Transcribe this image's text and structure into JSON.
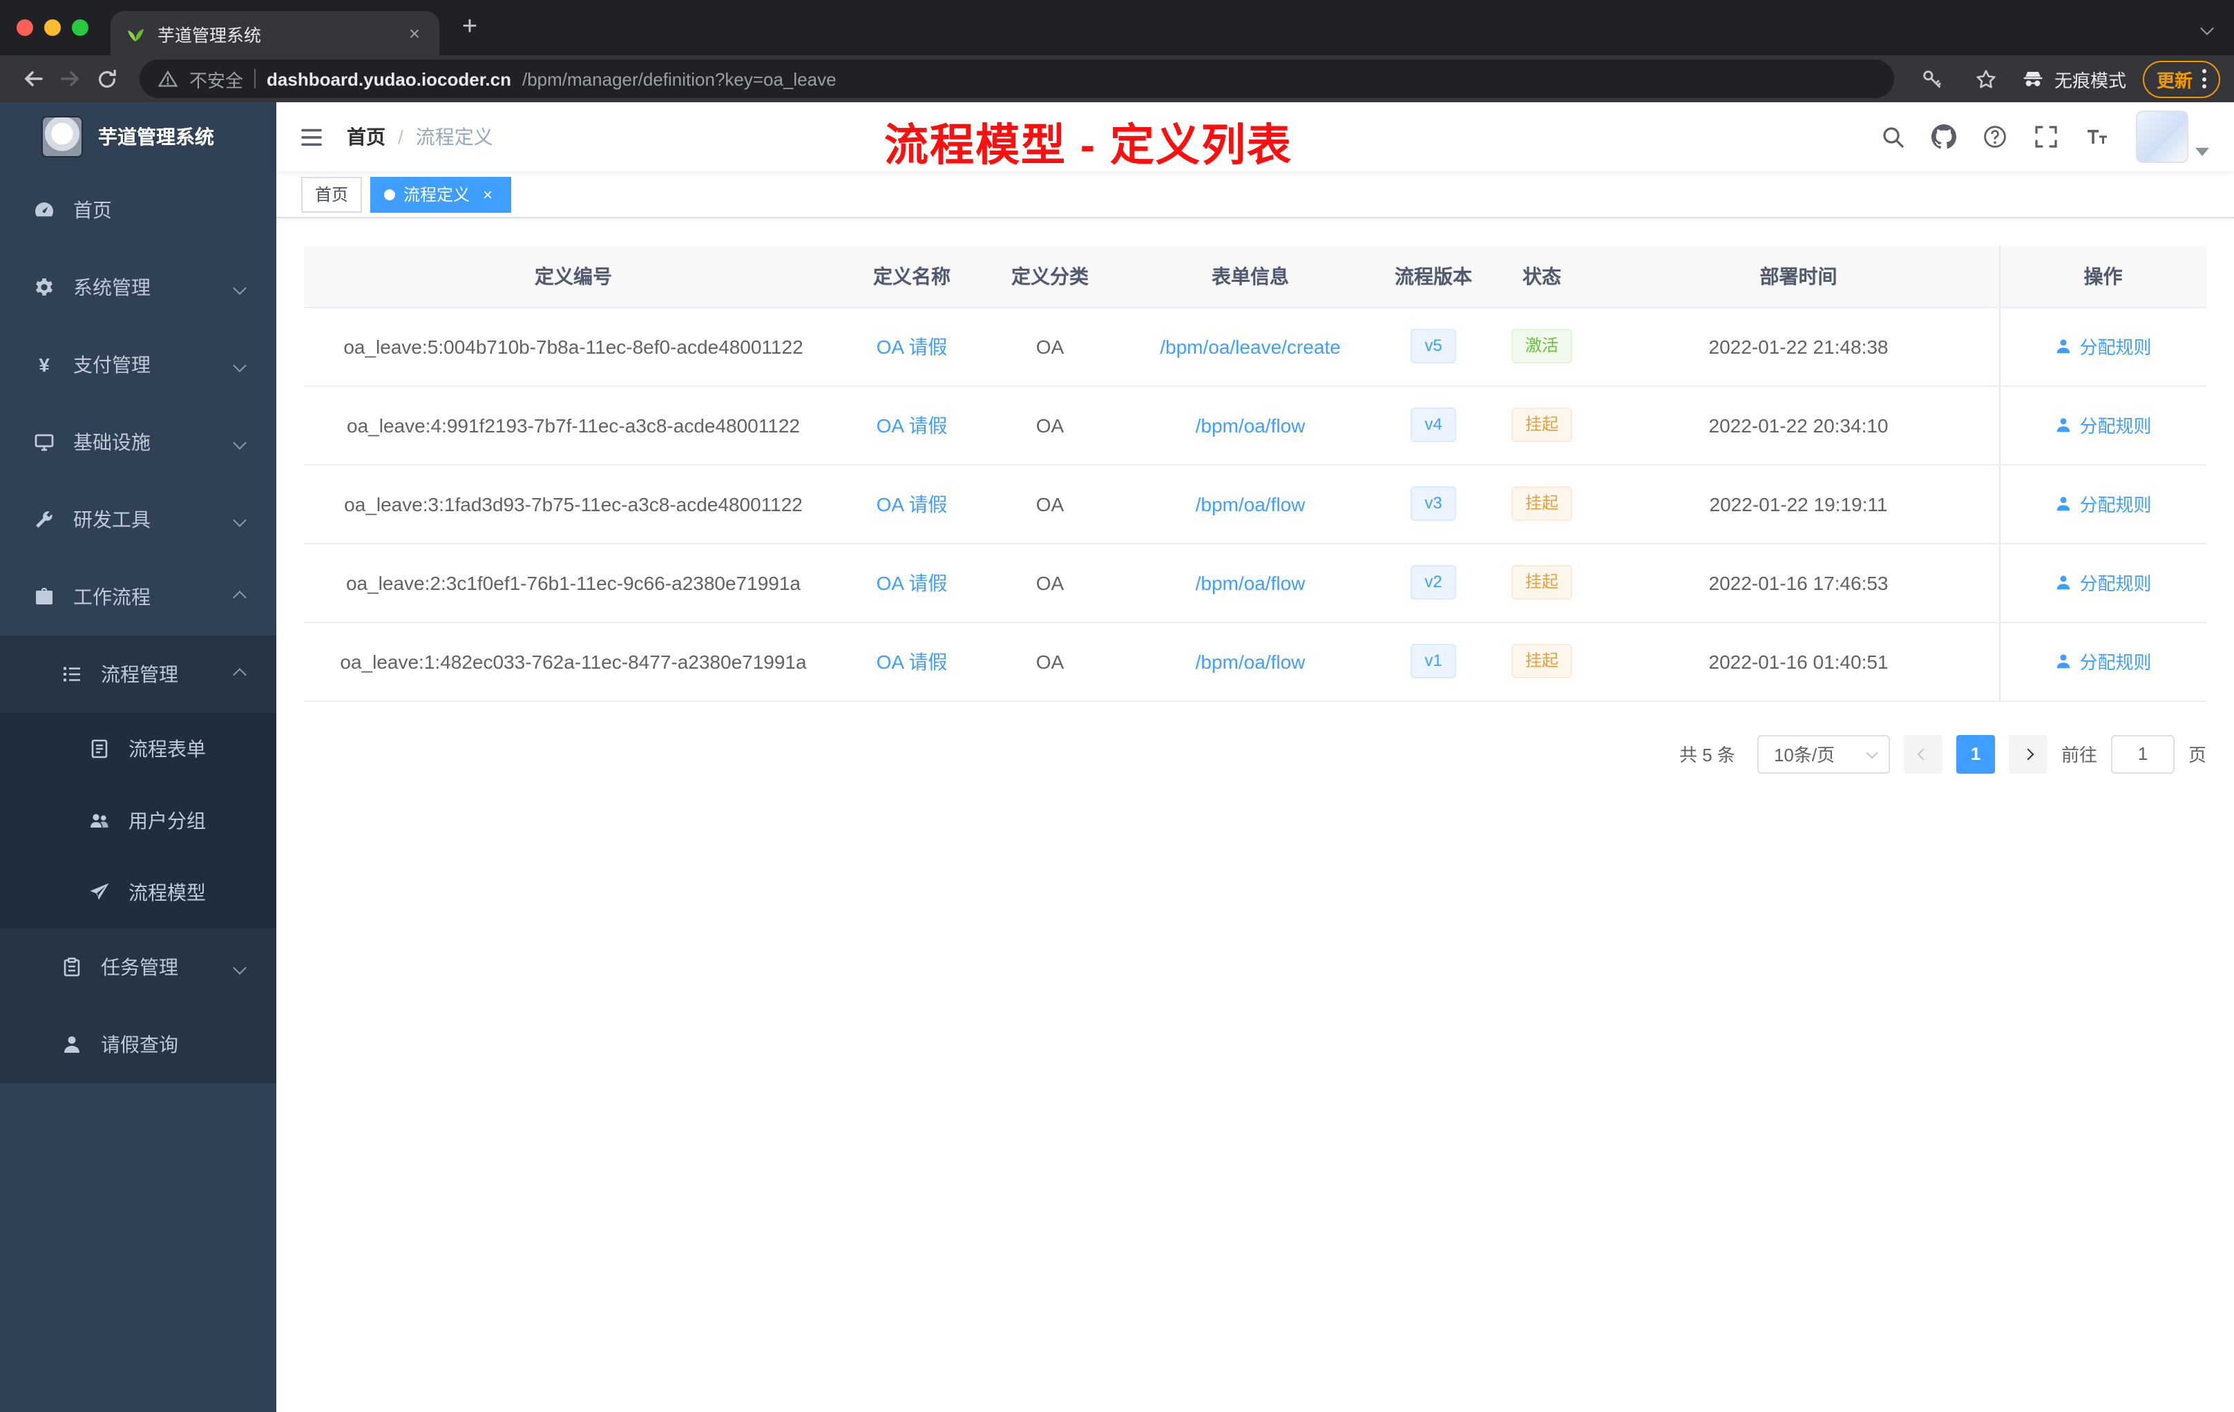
{
  "glyphs": {
    "close": "×",
    "plus": "+"
  },
  "colors": {
    "accent": "#409eff",
    "success": "#67c23a",
    "warning": "#e6a23c",
    "annotation_red": "#fb0f0f",
    "sidebar_bg": "#304156",
    "update_orange": "#f29900"
  },
  "browser": {
    "tab": {
      "title": "芋道管理系统"
    },
    "security_label": "不安全",
    "url_host": "dashboard.yudao.iocoder.cn",
    "url_path": "/bpm/manager/definition?key=oa_leave",
    "incognito_label": "无痕模式",
    "update_label": "更新"
  },
  "sidebar": {
    "logo_title": "芋道管理系统",
    "items": [
      {
        "label": "首页",
        "icon": "dashboard-icon"
      },
      {
        "label": "系统管理",
        "icon": "gear-icon"
      },
      {
        "label": "支付管理",
        "icon": "yen-icon"
      },
      {
        "label": "基础设施",
        "icon": "monitor-icon"
      },
      {
        "label": "研发工具",
        "icon": "wrench-icon"
      },
      {
        "label": "工作流程",
        "icon": "briefcase-icon"
      },
      {
        "label": "流程管理",
        "icon": "tree-list-icon"
      },
      {
        "label": "流程表单",
        "icon": "form-icon"
      },
      {
        "label": "用户分组",
        "icon": "users-icon"
      },
      {
        "label": "流程模型",
        "icon": "send-icon"
      },
      {
        "label": "任务管理",
        "icon": "clipboard-icon"
      },
      {
        "label": "请假查询",
        "icon": "person-icon"
      }
    ]
  },
  "navbar": {
    "breadcrumb": {
      "home": "首页",
      "separator": "/",
      "current": "流程定义"
    },
    "annotation": "流程模型 - 定义列表"
  },
  "tags": {
    "home": "首页",
    "active": "流程定义"
  },
  "table": {
    "columns": [
      "定义编号",
      "定义名称",
      "定义分类",
      "表单信息",
      "流程版本",
      "状态",
      "部署时间",
      "操作"
    ],
    "rows": [
      {
        "id": "oa_leave:5:004b710b-7b8a-11ec-8ef0-acde48001122",
        "name": "OA 请假",
        "category": "OA",
        "form": "/bpm/oa/leave/create",
        "version": "v5",
        "status": "激活",
        "deployed_at": "2022-01-22 21:48:38",
        "action": "分配规则"
      },
      {
        "id": "oa_leave:4:991f2193-7b7f-11ec-a3c8-acde48001122",
        "name": "OA 请假",
        "category": "OA",
        "form": "/bpm/oa/flow",
        "version": "v4",
        "status": "挂起",
        "deployed_at": "2022-01-22 20:34:10",
        "action": "分配规则"
      },
      {
        "id": "oa_leave:3:1fad3d93-7b75-11ec-a3c8-acde48001122",
        "name": "OA 请假",
        "category": "OA",
        "form": "/bpm/oa/flow",
        "version": "v3",
        "status": "挂起",
        "deployed_at": "2022-01-22 19:19:11",
        "action": "分配规则"
      },
      {
        "id": "oa_leave:2:3c1f0ef1-76b1-11ec-9c66-a2380e71991a",
        "name": "OA 请假",
        "category": "OA",
        "form": "/bpm/oa/flow",
        "version": "v2",
        "status": "挂起",
        "deployed_at": "2022-01-16 17:46:53",
        "action": "分配规则"
      },
      {
        "id": "oa_leave:1:482ec033-762a-11ec-8477-a2380e71991a",
        "name": "OA 请假",
        "category": "OA",
        "form": "/bpm/oa/flow",
        "version": "v1",
        "status": "挂起",
        "deployed_at": "2022-01-16 01:40:51",
        "action": "分配规则"
      }
    ]
  },
  "pagination": {
    "total": "共 5 条",
    "page_size": "10条/页",
    "page": "1",
    "goto_label": "前往",
    "goto_value": "1",
    "unit": "页"
  }
}
